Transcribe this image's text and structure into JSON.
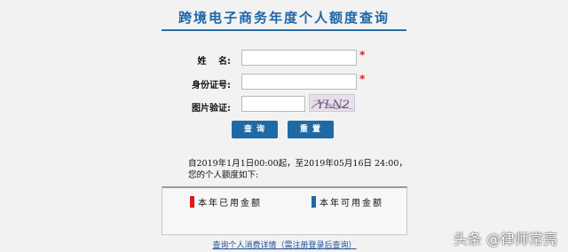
{
  "title": "跨境电子商务年度个人额度查询",
  "form": {
    "name_label": "姓　 名:",
    "id_label": "身份证号:",
    "captcha_label": "图片验证:",
    "required_mark": "*",
    "name_value": "",
    "id_value": "",
    "captcha_value": "",
    "captcha_text": "YLN2"
  },
  "buttons": {
    "query": "查 询",
    "reset": "重 置"
  },
  "info": {
    "line1": "自2019年1月1日00:00起，至2019年05月16日 24:00，",
    "line2": "您的个人额度如下:"
  },
  "legend": {
    "used": {
      "label": "本年已用金额",
      "color": "#e01a1a"
    },
    "available": {
      "label": "本年可用金额",
      "color": "#1f6aa5"
    }
  },
  "link": "查询个人消费详情（需注册登录后查询）",
  "watermark": "头条 @律师常亮"
}
